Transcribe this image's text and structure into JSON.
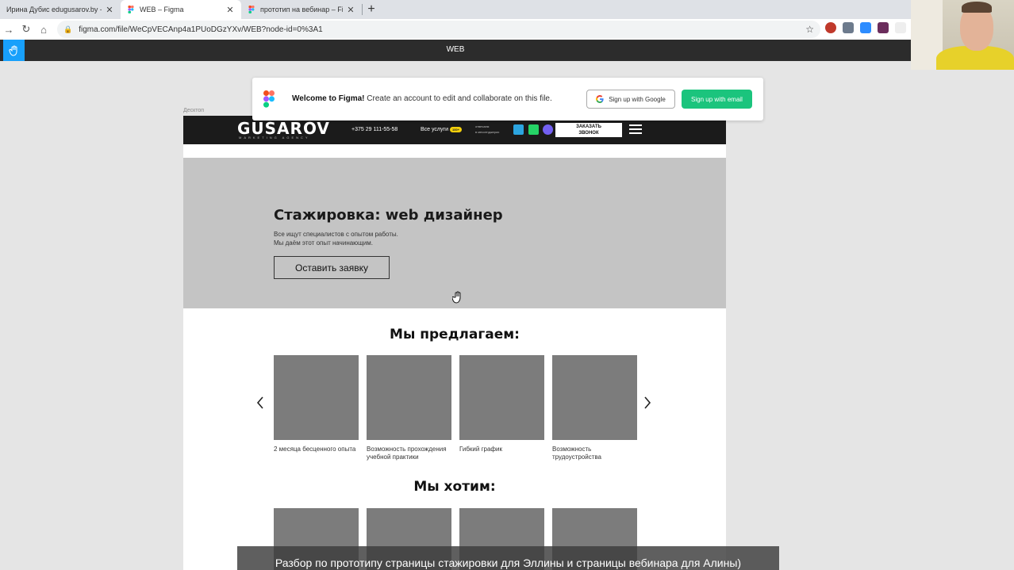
{
  "browser": {
    "tabs": [
      {
        "label": "Ирина Дубис edugusarov.by - ...",
        "active": false
      },
      {
        "label": "WEB – Figma",
        "active": true
      },
      {
        "label": "прототип на вебинар – Figma",
        "active": false
      }
    ],
    "url": "figma.com/file/WeCpVECAnp4a1PUoDGzYXv/WEB?node-id=0%3A1"
  },
  "figma": {
    "file_title": "WEB",
    "banner": {
      "welcome_bold": "Welcome to Figma!",
      "welcome_text": " Create an account to edit and collaborate on this file.",
      "google_button": "Sign up with Google",
      "email_button": "Sign up with email"
    },
    "frame_label": "Десктоп"
  },
  "site": {
    "header": {
      "brand": "GUSAROV",
      "brand_sub": "MARKETING AGENCY",
      "phone": "+375 29 111-55-58",
      "services": "Все услуги",
      "services_badge": "100+",
      "reply_line1": "отвечаем",
      "reply_line2": "в мессенджерах",
      "callback_line1": "ЗАКАЗАТЬ",
      "callback_line2": "ЗВОНОК"
    },
    "hero": {
      "title": "Стажировка: web дизайнер",
      "text_line1": "Все ищут специалистов с опытом работы.",
      "text_line2": "Мы даём этот опыт начинающим.",
      "button": "Оставить заявку"
    },
    "offer": {
      "title": "Мы предлагаем:",
      "cards": [
        {
          "text": "2 месяца бесценного опыта"
        },
        {
          "text": "Возможность прохождения учебной практики"
        },
        {
          "text": "Гибкий график"
        },
        {
          "text": "Возможность трудоустройства"
        }
      ]
    },
    "want": {
      "title": "Мы хотим:"
    }
  },
  "caption": "Разбор по прототипу страницы стажировки для Эллины и страницы вебинара для Алины)",
  "colors": {
    "figma_blue": "#18a0fb",
    "figma_green": "#1bc47d",
    "header_dark": "#1b1b1b",
    "hero_gray": "#c4c4c4",
    "card_gray": "#7c7c7c",
    "badge_yellow": "#f4d00b"
  }
}
